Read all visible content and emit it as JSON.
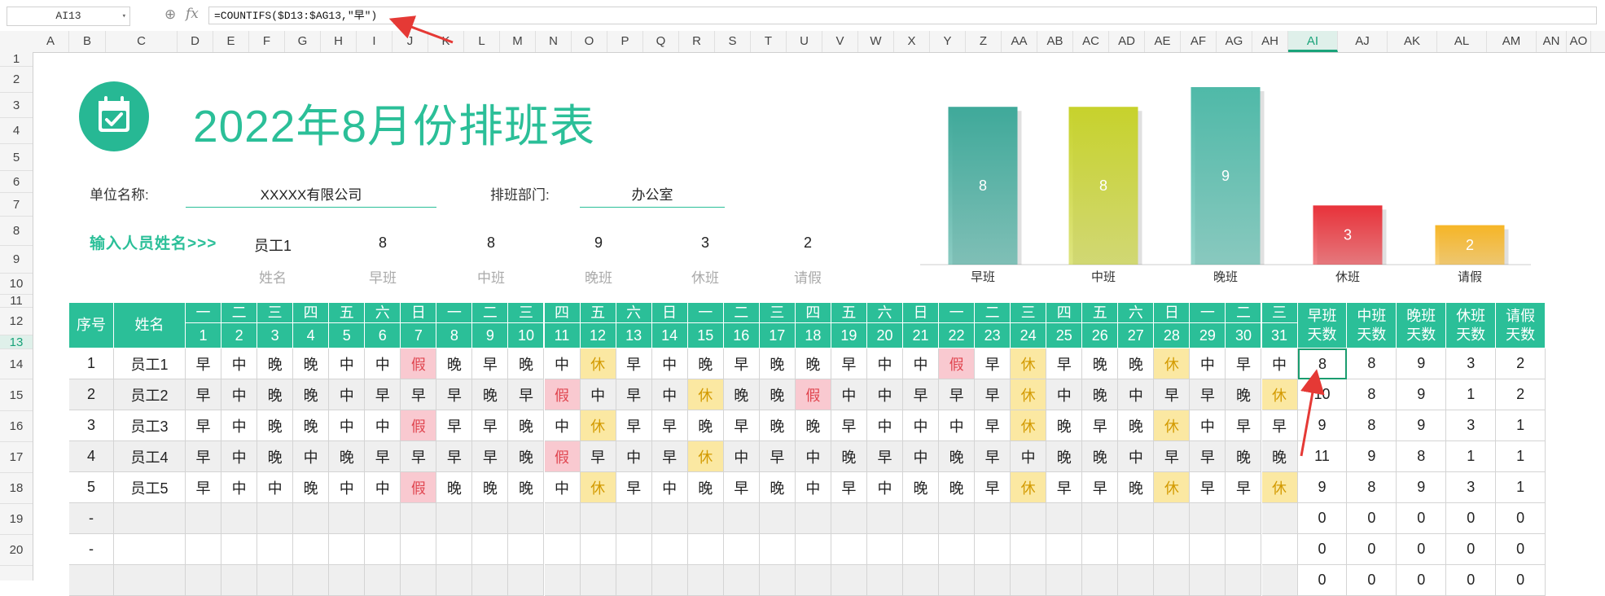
{
  "formula_bar": {
    "cell_ref": "AI13",
    "formula": "=COUNTIFS($D13:$AG13,\"早\")",
    "zoom_icon": "zoom-icon",
    "fx_label": "fx"
  },
  "columns": [
    "A",
    "B",
    "C",
    "D",
    "E",
    "F",
    "G",
    "H",
    "I",
    "J",
    "K",
    "L",
    "M",
    "N",
    "O",
    "P",
    "Q",
    "R",
    "S",
    "T",
    "U",
    "V",
    "W",
    "X",
    "Y",
    "Z",
    "AA",
    "AB",
    "AC",
    "AD",
    "AE",
    "AF",
    "AG",
    "AH",
    "AI",
    "AJ",
    "AK",
    "AL",
    "AM",
    "AN",
    "AO"
  ],
  "selected_column": "AI",
  "rows": [
    "1",
    "2",
    "3",
    "4",
    "5",
    "6",
    "7",
    "8",
    "9",
    "10",
    "11",
    "12",
    "13",
    "14",
    "15",
    "16",
    "17",
    "18",
    "19",
    "20"
  ],
  "selected_row": "13",
  "title": "2022年8月份排班表",
  "company_label": "单位名称:",
  "company_value": "XXXXX有限公司",
  "dept_label": "排班部门:",
  "dept_value": "办公室",
  "input_prompt": "输入人员姓名>>>",
  "summary": {
    "values": [
      "员工1",
      "8",
      "8",
      "9",
      "3",
      "2"
    ],
    "labels": [
      "姓名",
      "早班",
      "中班",
      "晚班",
      "休班",
      "请假"
    ]
  },
  "chart_data": {
    "type": "bar",
    "categories": [
      "早班",
      "中班",
      "晚班",
      "休班",
      "请假"
    ],
    "values": [
      8,
      8,
      9,
      3,
      2
    ],
    "colors": [
      "#3fa99a",
      "#c7d22c",
      "#4fb9a8",
      "#e8323a",
      "#f6b526"
    ],
    "ylim": [
      0,
      9
    ],
    "title": "",
    "xlabel": "",
    "ylabel": ""
  },
  "table": {
    "header_seq": "序号",
    "header_name": "姓名",
    "weekdays": [
      "一",
      "二",
      "三",
      "四",
      "五",
      "六",
      "日",
      "一",
      "二",
      "三",
      "四",
      "五",
      "六",
      "日",
      "一",
      "二",
      "三",
      "四",
      "五",
      "六",
      "日",
      "一",
      "二",
      "三",
      "四",
      "五",
      "六",
      "日",
      "一",
      "二",
      "三"
    ],
    "days": [
      "1",
      "2",
      "3",
      "4",
      "5",
      "6",
      "7",
      "8",
      "9",
      "10",
      "11",
      "12",
      "13",
      "14",
      "15",
      "16",
      "17",
      "18",
      "19",
      "20",
      "21",
      "22",
      "23",
      "24",
      "25",
      "26",
      "27",
      "28",
      "29",
      "30",
      "31"
    ],
    "summary_headers": [
      [
        "早班",
        "天数"
      ],
      [
        "中班",
        "天数"
      ],
      [
        "晚班",
        "天数"
      ],
      [
        "休班",
        "天数"
      ],
      [
        "请假",
        "天数"
      ]
    ],
    "rows": [
      {
        "seq": "1",
        "name": "员工1",
        "shifts": [
          "早",
          "中",
          "晚",
          "晚",
          "中",
          "中",
          "假",
          "晚",
          "早",
          "晚",
          "中",
          "休",
          "早",
          "中",
          "晚",
          "早",
          "晚",
          "晚",
          "早",
          "中",
          "中",
          "假",
          "早",
          "休",
          "早",
          "晚",
          "晚",
          "休",
          "中",
          "早",
          "中"
        ],
        "totals": [
          "8",
          "8",
          "9",
          "3",
          "2"
        ]
      },
      {
        "seq": "2",
        "name": "员工2",
        "shifts": [
          "早",
          "中",
          "晚",
          "晚",
          "中",
          "早",
          "早",
          "早",
          "晚",
          "早",
          "假",
          "中",
          "早",
          "中",
          "休",
          "晚",
          "晚",
          "假",
          "中",
          "中",
          "早",
          "早",
          "早",
          "休",
          "中",
          "晚",
          "中",
          "早",
          "早",
          "晚",
          "休"
        ],
        "totals": [
          "10",
          "8",
          "9",
          "1",
          "2"
        ]
      },
      {
        "seq": "3",
        "name": "员工3",
        "shifts": [
          "早",
          "中",
          "晚",
          "晚",
          "中",
          "中",
          "假",
          "早",
          "早",
          "晚",
          "中",
          "休",
          "早",
          "早",
          "晚",
          "早",
          "晚",
          "晚",
          "早",
          "中",
          "中",
          "中",
          "早",
          "休",
          "晚",
          "早",
          "晚",
          "休",
          "中",
          "早",
          "早"
        ],
        "totals": [
          "9",
          "8",
          "9",
          "3",
          "1"
        ]
      },
      {
        "seq": "4",
        "name": "员工4",
        "shifts": [
          "早",
          "中",
          "晚",
          "中",
          "晚",
          "早",
          "早",
          "早",
          "早",
          "晚",
          "假",
          "早",
          "中",
          "早",
          "休",
          "中",
          "早",
          "中",
          "晚",
          "早",
          "中",
          "晚",
          "早",
          "中",
          "晚",
          "晚",
          "中",
          "早",
          "早",
          "晚",
          "晚"
        ],
        "totals": [
          "11",
          "9",
          "8",
          "1",
          "1"
        ]
      },
      {
        "seq": "5",
        "name": "员工5",
        "shifts": [
          "早",
          "中",
          "中",
          "晚",
          "中",
          "中",
          "假",
          "晚",
          "晚",
          "晚",
          "中",
          "休",
          "早",
          "中",
          "晚",
          "早",
          "晚",
          "中",
          "早",
          "中",
          "晚",
          "晚",
          "早",
          "休",
          "早",
          "早",
          "晚",
          "休",
          "早",
          "早",
          "休"
        ],
        "totals": [
          "9",
          "8",
          "9",
          "3",
          "1"
        ]
      },
      {
        "seq": "-",
        "name": "",
        "shifts": [],
        "totals": [
          "0",
          "0",
          "0",
          "0",
          "0"
        ]
      },
      {
        "seq": "-",
        "name": "",
        "shifts": [],
        "totals": [
          "0",
          "0",
          "0",
          "0",
          "0"
        ]
      },
      {
        "seq": "",
        "name": "",
        "shifts": [],
        "totals": [
          "0",
          "0",
          "0",
          "0",
          "0"
        ]
      }
    ]
  }
}
